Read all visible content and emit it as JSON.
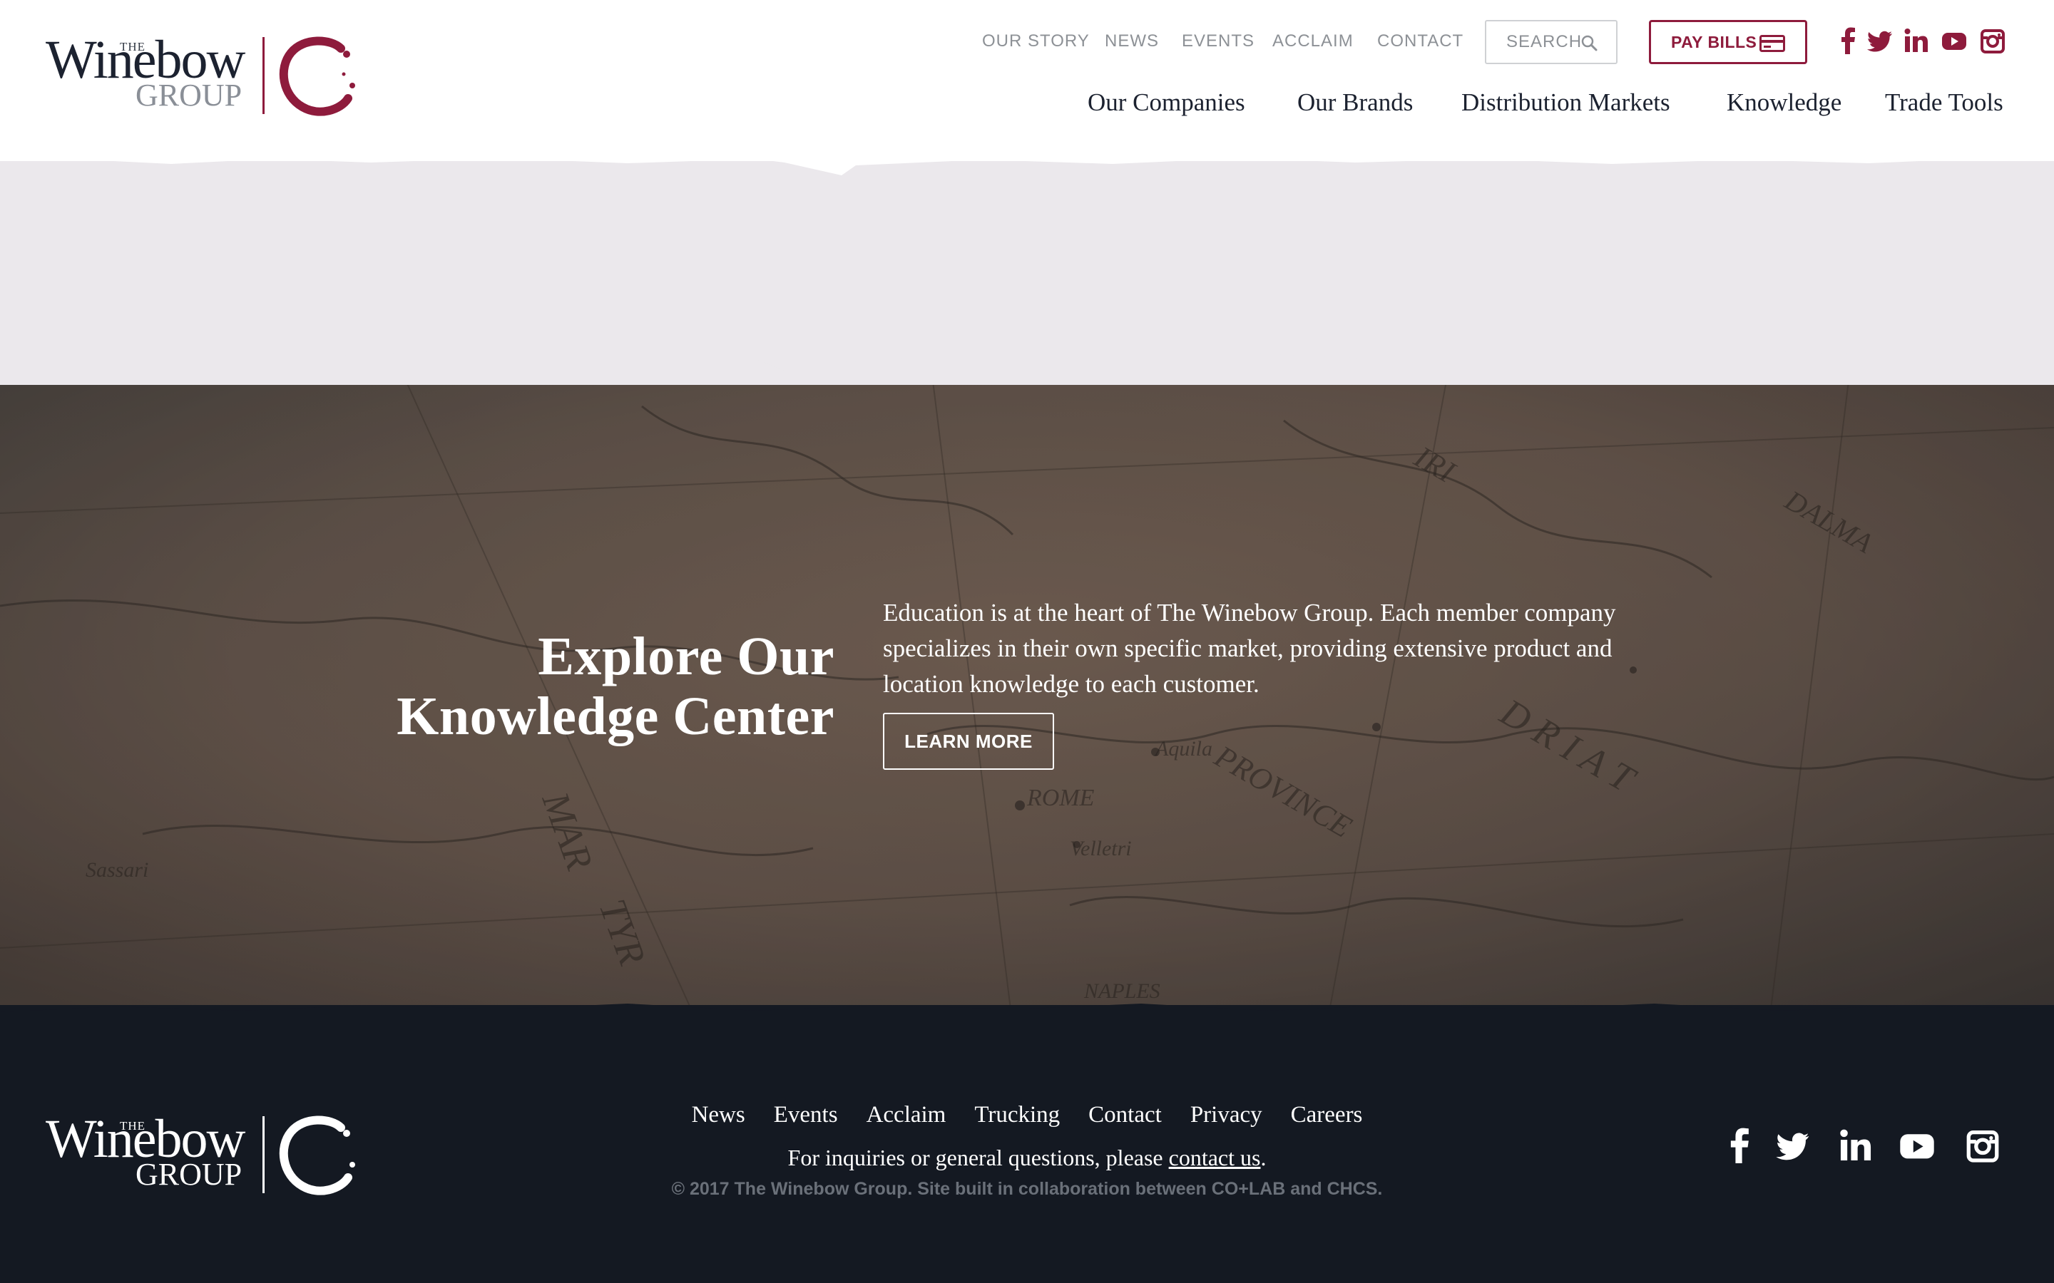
{
  "brand": {
    "the": "THE",
    "name": "Winebow",
    "group": "GROUP",
    "accent_color": "#8e1b3c"
  },
  "header": {
    "utility_links": [
      "OUR STORY",
      "NEWS",
      "EVENTS",
      "ACCLAIM",
      "CONTACT"
    ],
    "search_placeholder": "SEARCH",
    "pay_bills_label": "PAY BILLS",
    "social_icons": [
      "facebook-icon",
      "twitter-icon",
      "linkedin-icon",
      "youtube-icon",
      "instagram-icon"
    ],
    "main_nav": [
      "Our Companies",
      "Our Brands",
      "Distribution Markets",
      "Knowledge",
      "Trade Tools"
    ]
  },
  "hero": {
    "title_line1": "Explore Our",
    "title_line2": "Knowledge Center",
    "text": "Education is at the heart of The Winebow Group. Each member company specializes in their own specific market, providing extensive product and location knowledge to each customer.",
    "button_label": "LEARN MORE",
    "background": "antique map"
  },
  "footer": {
    "links": [
      "News",
      "Events",
      "Acclaim",
      "Trucking",
      "Contact",
      "Privacy",
      "Careers"
    ],
    "inquiry_prefix": "For inquiries or general questions, please ",
    "inquiry_link": "contact us",
    "inquiry_suffix": ".",
    "copyright": "© 2017 The Winebow Group. Site built in collaboration between CO+LAB and CHCS.",
    "social_icons": [
      "facebook-icon",
      "twitter-icon",
      "linkedin-icon",
      "youtube-icon",
      "instagram-icon"
    ],
    "background_color": "#141922"
  }
}
